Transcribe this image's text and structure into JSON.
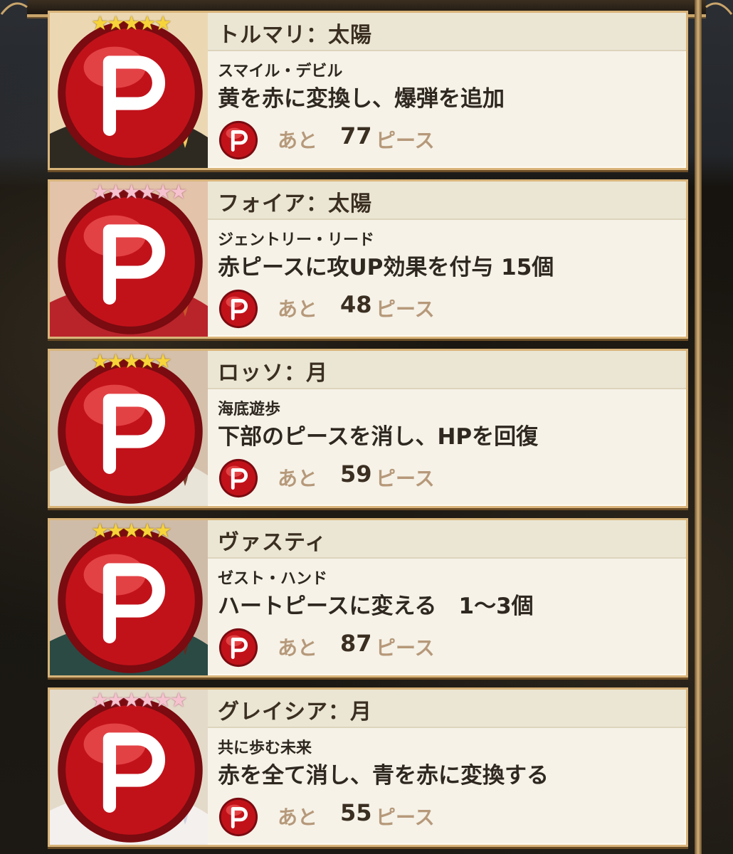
{
  "labels": {
    "remaining": "あと",
    "unit": "ピース",
    "piece_badge": "P"
  },
  "colors": {
    "accent": "#d9b47a",
    "gold_star": "#f7d43a",
    "pink_star": "#f6c2cf",
    "piece_red": "#c1121a"
  },
  "cards": [
    {
      "name": "トルマリ：太陽",
      "skill_name": "スマイル・デビル",
      "skill_desc": "黄を赤に変換し、爆弾を追加",
      "count": "77",
      "stars": 5,
      "star_color": "gold",
      "hair": "#f3c860",
      "skin": "#f7dcc8",
      "outfit": "#2e2a22"
    },
    {
      "name": "フォイア：太陽",
      "skill_name": "ジェントリー・リード",
      "skill_desc": "赤ピースに攻UP効果を付与 15個",
      "count": "48",
      "stars": 6,
      "star_color": "pink",
      "hair": "#c9552a",
      "skin": "#f4d3b8",
      "outfit": "#b8242a"
    },
    {
      "name": "ロッソ：月",
      "skill_name": "海底遊歩",
      "skill_desc": "下部のピースを消し、HPを回復",
      "count": "59",
      "stars": 5,
      "star_color": "gold",
      "hair": "#7a4330",
      "skin": "#f4d8c6",
      "outfit": "#e9e4d8"
    },
    {
      "name": "ヴァスティ",
      "skill_name": "ゼスト・ハンド",
      "skill_desc": "ハートピースに変える　1～3個",
      "count": "87",
      "stars": 5,
      "star_color": "gold",
      "hair": "#5a2e24",
      "skin": "#f1d1bb",
      "outfit": "#2b4a44"
    },
    {
      "name": "グレイシア：月",
      "skill_name": "共に歩む未来",
      "skill_desc": "赤を全て消し、青を赤に変換する",
      "count": "55",
      "stars": 6,
      "star_color": "pink",
      "hair": "#cfd3e0",
      "skin": "#f6e0d4",
      "outfit": "#f3f0ee"
    }
  ]
}
